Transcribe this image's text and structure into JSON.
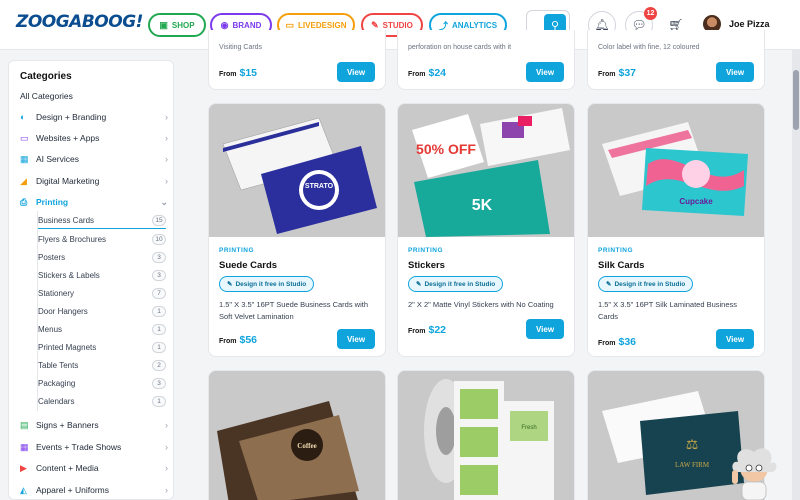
{
  "header": {
    "logo": "ZOOGABOOG!",
    "nav": [
      {
        "label": "SHOP",
        "icon": "bag-icon",
        "color": "#22a851"
      },
      {
        "label": "BRAND",
        "icon": "palette-icon",
        "color": "#7c3aed"
      },
      {
        "label": "LIVEDESIGN",
        "icon": "monitor-icon",
        "color": "#f59e0b"
      },
      {
        "label": "STUDIO",
        "icon": "pen-icon",
        "color": "#ef4444"
      },
      {
        "label": "ANALYTICS",
        "icon": "chart-icon",
        "color": "#10a4dd"
      }
    ],
    "messages_badge": "12",
    "user_name": "Joe Pizza"
  },
  "sidebar": {
    "title": "Categories",
    "all": "All Categories",
    "top_items": [
      {
        "label": "Design + Branding",
        "icon": "palette-icon"
      },
      {
        "label": "Websites + Apps",
        "icon": "laptop-icon"
      },
      {
        "label": "AI Services",
        "icon": "ai-icon"
      },
      {
        "label": "Digital Marketing",
        "icon": "megaphone-icon"
      },
      {
        "label": "Printing",
        "icon": "printer-icon"
      }
    ],
    "sub_items": [
      {
        "label": "Business Cards",
        "count": "15"
      },
      {
        "label": "Flyers & Brochures",
        "count": "10"
      },
      {
        "label": "Posters",
        "count": "3"
      },
      {
        "label": "Stickers & Labels",
        "count": "3"
      },
      {
        "label": "Stationery",
        "count": "7"
      },
      {
        "label": "Door Hangers",
        "count": "1"
      },
      {
        "label": "Menus",
        "count": "1"
      },
      {
        "label": "Printed Magnets",
        "count": "1"
      },
      {
        "label": "Table Tents",
        "count": "2"
      },
      {
        "label": "Packaging",
        "count": "3"
      },
      {
        "label": "Calendars",
        "count": "1"
      }
    ],
    "bottom_items": [
      {
        "label": "Signs + Banners",
        "icon": "sign-icon"
      },
      {
        "label": "Events + Trade Shows",
        "icon": "calendar-icon"
      },
      {
        "label": "Content + Media",
        "icon": "play-icon"
      },
      {
        "label": "Apparel + Uniforms",
        "icon": "shirt-icon"
      }
    ]
  },
  "top_row": [
    {
      "from": "From",
      "price": "$15",
      "view": "View",
      "cut": "Visiting Cards"
    },
    {
      "from": "From",
      "price": "$24",
      "view": "View",
      "cut": "perforation on house cards with it"
    },
    {
      "from": "From",
      "price": "$37",
      "view": "View",
      "cut": "Color label with fine, 12 coloured"
    }
  ],
  "cards": [
    {
      "category": "PRINTING",
      "title": "Suede Cards",
      "studio": "Design it free in Studio",
      "desc": "1.5\" X 3.5\" 16PT Suede Business Cards with Soft Velvet Lamination",
      "from": "From",
      "price": "$56",
      "view": "View",
      "img_text": "STRATO"
    },
    {
      "category": "PRINTING",
      "title": "Stickers",
      "studio": "Design it free in Studio",
      "desc": "2\" X 2\" Matte Vinyl Stickers with No Coating",
      "from": "From",
      "price": "$22",
      "view": "View",
      "img_text": "50% OFF"
    },
    {
      "category": "PRINTING",
      "title": "Silk Cards",
      "studio": "Design it free in Studio",
      "desc": "1.5\" X 3.5\" 16PT Silk Laminated Business Cards",
      "from": "From",
      "price": "$36",
      "view": "View",
      "img_text": "Cupcake"
    }
  ],
  "bottom_cards": [
    {
      "img_text": "Coffee"
    },
    {
      "img_text": "Fresh"
    },
    {
      "img_text": "LAW FIRM"
    }
  ]
}
